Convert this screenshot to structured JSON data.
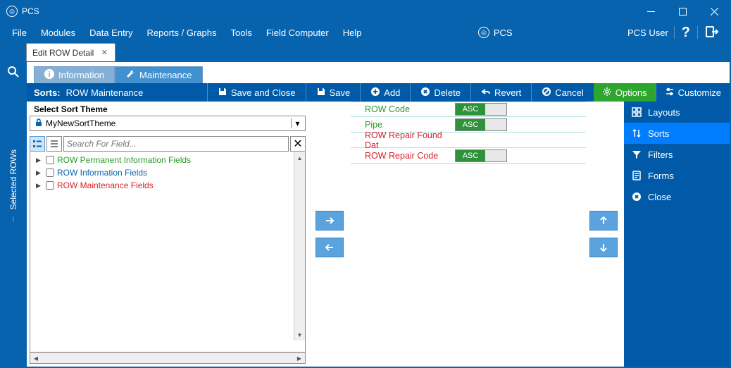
{
  "window": {
    "title": "PCS"
  },
  "menu": {
    "items": [
      "File",
      "Modules",
      "Data Entry",
      "Reports / Graphs",
      "Tools",
      "Field Computer",
      "Help"
    ],
    "app_label": "PCS",
    "user": "PCS User"
  },
  "tab": {
    "label": "Edit ROW Detail"
  },
  "section_tabs": {
    "information": "Information",
    "maintenance": "Maintenance"
  },
  "toolbar": {
    "sorts_label": "Sorts:",
    "sort_name": "ROW Maintenance",
    "save_close": "Save and Close",
    "save": "Save",
    "add": "Add",
    "delete": "Delete",
    "revert": "Revert",
    "cancel": "Cancel",
    "options": "Options",
    "customize": "Customize"
  },
  "theme": {
    "label": "Select Sort Theme",
    "value": "MyNewSortTheme"
  },
  "search": {
    "placeholder": "Search For Field..."
  },
  "tree": {
    "items": [
      {
        "label": "ROW Permanent Information Fields",
        "cls": "green-txt"
      },
      {
        "label": "ROW Information Fields",
        "cls": "blue-txt"
      },
      {
        "label": "ROW Maintenance Fields",
        "cls": "red-txt"
      }
    ]
  },
  "sort_rows": [
    {
      "label": "ROW Code",
      "cls": "green-txt",
      "toggle": "ASC"
    },
    {
      "label": "Pipe",
      "cls": "green-txt",
      "toggle": "ASC"
    },
    {
      "label": "ROW Repair Found Dat",
      "cls": "red-txt",
      "toggle": null
    },
    {
      "label": "ROW Repair Code",
      "cls": "red-txt",
      "toggle": "ASC"
    }
  ],
  "sidebar_text": "Selected ROWs",
  "side_menu": {
    "layouts": "Layouts",
    "sorts": "Sorts",
    "filters": "Filters",
    "forms": "Forms",
    "close": "Close"
  }
}
